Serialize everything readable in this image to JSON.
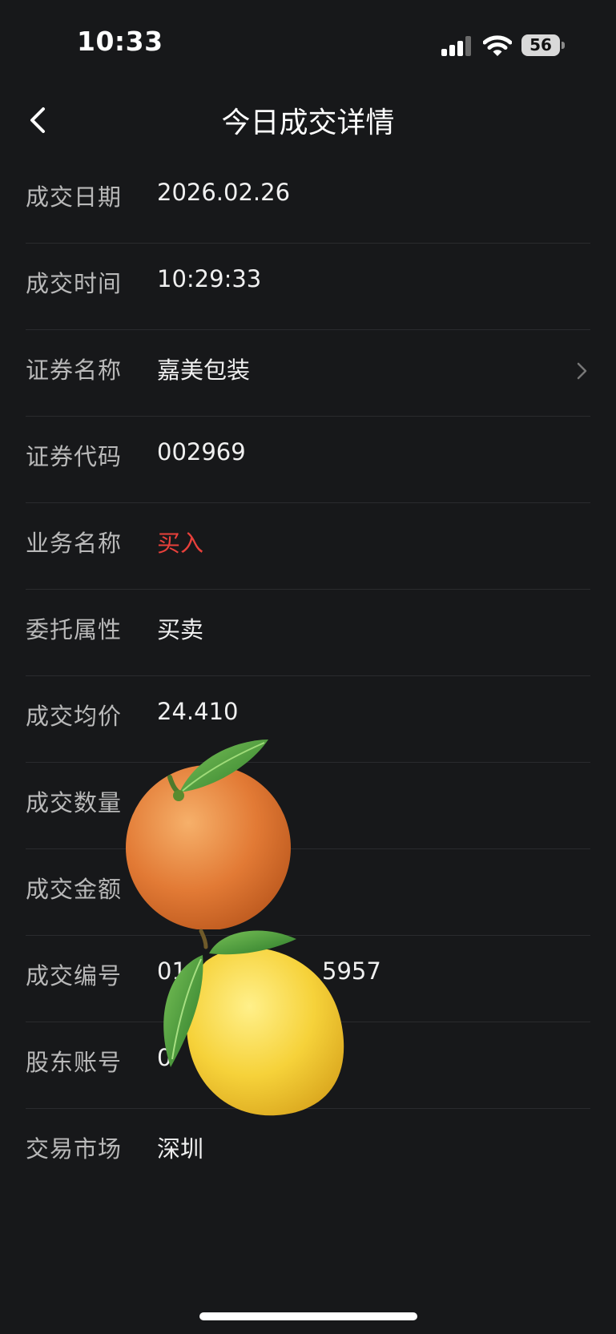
{
  "status_bar": {
    "time": "10:33",
    "battery": "56"
  },
  "nav": {
    "title": "今日成交详情"
  },
  "rows": [
    {
      "label": "成交日期",
      "value": "2026.02.26"
    },
    {
      "label": "成交时间",
      "value": "10:29:33"
    },
    {
      "label": "证券名称",
      "value": "嘉美包装"
    },
    {
      "label": "证券代码",
      "value": "002969"
    },
    {
      "label": "业务名称",
      "value": "买入"
    },
    {
      "label": "委托属性",
      "value": "买卖"
    },
    {
      "label": "成交均价",
      "value": "24.410"
    },
    {
      "label": "成交数量",
      "value": ""
    },
    {
      "label": "成交金额",
      "value": ""
    },
    {
      "label": "成交编号",
      "value": "01",
      "value_tail": "5957"
    },
    {
      "label": "股东账号",
      "value": "0"
    },
    {
      "label": "交易市场",
      "value": "深圳"
    }
  ],
  "colors": {
    "background": "#17181a",
    "buy_red": "#e8403b",
    "label_gray": "#b9b9b9"
  },
  "icons": {
    "back": "chevron-left-icon",
    "row_arrow": "chevron-right-icon",
    "signal": "cellular-signal-icon",
    "wifi": "wifi-icon",
    "battery": "battery-icon",
    "sticker_1": "orange-emoji",
    "sticker_2": "lemon-emoji"
  }
}
